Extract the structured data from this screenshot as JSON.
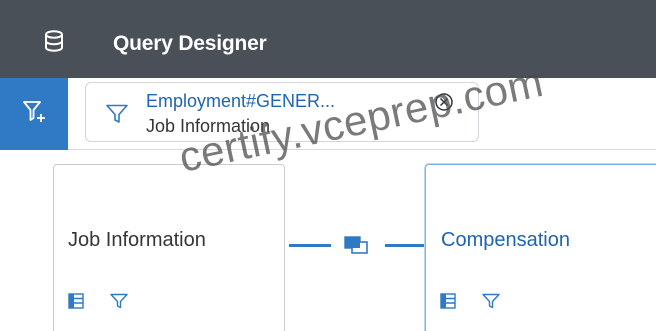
{
  "header": {
    "title": "Query Designer",
    "icon": "database-icon"
  },
  "filter_bar": {
    "add_filter_icon": "add-filter-icon",
    "chip": {
      "title": "Employment#GENER...",
      "subtitle": "Job Information",
      "icon": "filter-icon",
      "close_icon": "close-circle-icon"
    }
  },
  "entities": [
    {
      "label": "Job Information",
      "tools": [
        "table-icon",
        "filter-icon"
      ]
    },
    {
      "label": "Compensation",
      "tools": [
        "table-icon",
        "filter-icon"
      ]
    }
  ],
  "join": {
    "icon": "join-icon"
  },
  "watermark": "certify.vceprep.com",
  "colors": {
    "header_bg": "#4a5058",
    "accent": "#2f79c5",
    "link": "#1f64b0"
  }
}
